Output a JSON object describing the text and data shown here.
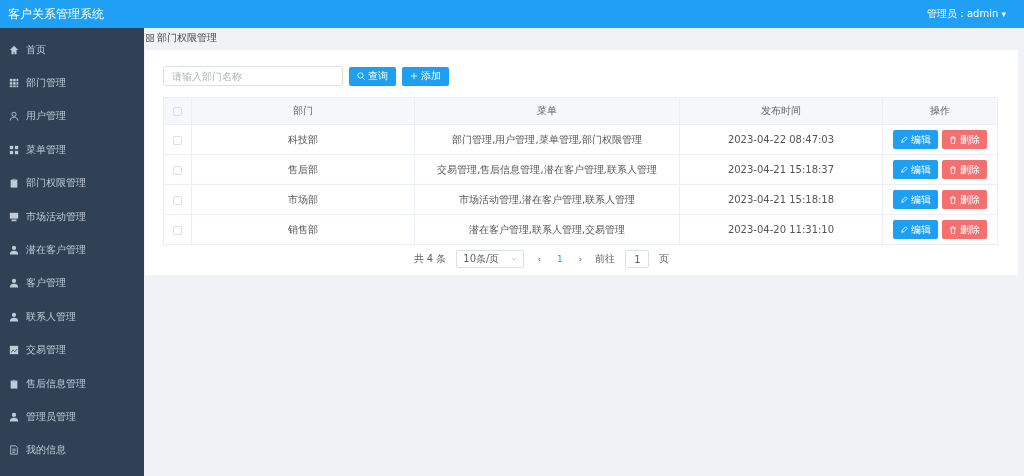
{
  "header": {
    "title": "客户关系管理系统",
    "user": "管理员：admin",
    "caret": "▾"
  },
  "sidebar": {
    "items": [
      {
        "label": "首页"
      },
      {
        "label": "部门管理"
      },
      {
        "label": "用户管理"
      },
      {
        "label": "菜单管理"
      },
      {
        "label": "部门权限管理"
      },
      {
        "label": "市场活动管理"
      },
      {
        "label": "潜在客户管理"
      },
      {
        "label": "客户管理"
      },
      {
        "label": "联系人管理"
      },
      {
        "label": "交易管理"
      },
      {
        "label": "售后信息管理"
      },
      {
        "label": "管理员管理"
      },
      {
        "label": "我的信息"
      }
    ]
  },
  "breadcrumb": "部门权限管理",
  "toolbar": {
    "search": {
      "placeholder": "请输入部门名称"
    },
    "query_button": "查询",
    "add_button": "添加"
  },
  "table": {
    "select_all": {
      "checked": false
    },
    "columns": [
      "部门",
      "菜单",
      "发布时间",
      "操作"
    ],
    "rows": [
      {
        "checked": false,
        "department": "科技部",
        "menus": "部门管理,用户管理,菜单管理,部门权限管理",
        "time": "2023-04-22 08:47:03",
        "edit": "编辑",
        "delete": "删除"
      },
      {
        "checked": false,
        "department": "售后部",
        "menus": "交易管理,售后信息管理,潜在客户管理,联系人管理",
        "time": "2023-04-21 15:18:37",
        "edit": "编辑",
        "delete": "删除"
      },
      {
        "checked": false,
        "department": "市场部",
        "menus": "市场活动管理,潜在客户管理,联系人管理",
        "time": "2023-04-21 15:18:18",
        "edit": "编辑",
        "delete": "删除"
      },
      {
        "checked": false,
        "department": "销售部",
        "menus": "潜在客户管理,联系人管理,交易管理",
        "time": "2023-04-20 11:31:10",
        "edit": "编辑",
        "delete": "删除"
      }
    ]
  },
  "pagination": {
    "total": "共 4 条",
    "page_size": "10条/页",
    "prev": "‹",
    "pages": [
      {
        "label": "1",
        "selected": true
      }
    ],
    "next": "›",
    "goto_label": "前往",
    "goto_value": "1",
    "goto_suffix": "页"
  }
}
